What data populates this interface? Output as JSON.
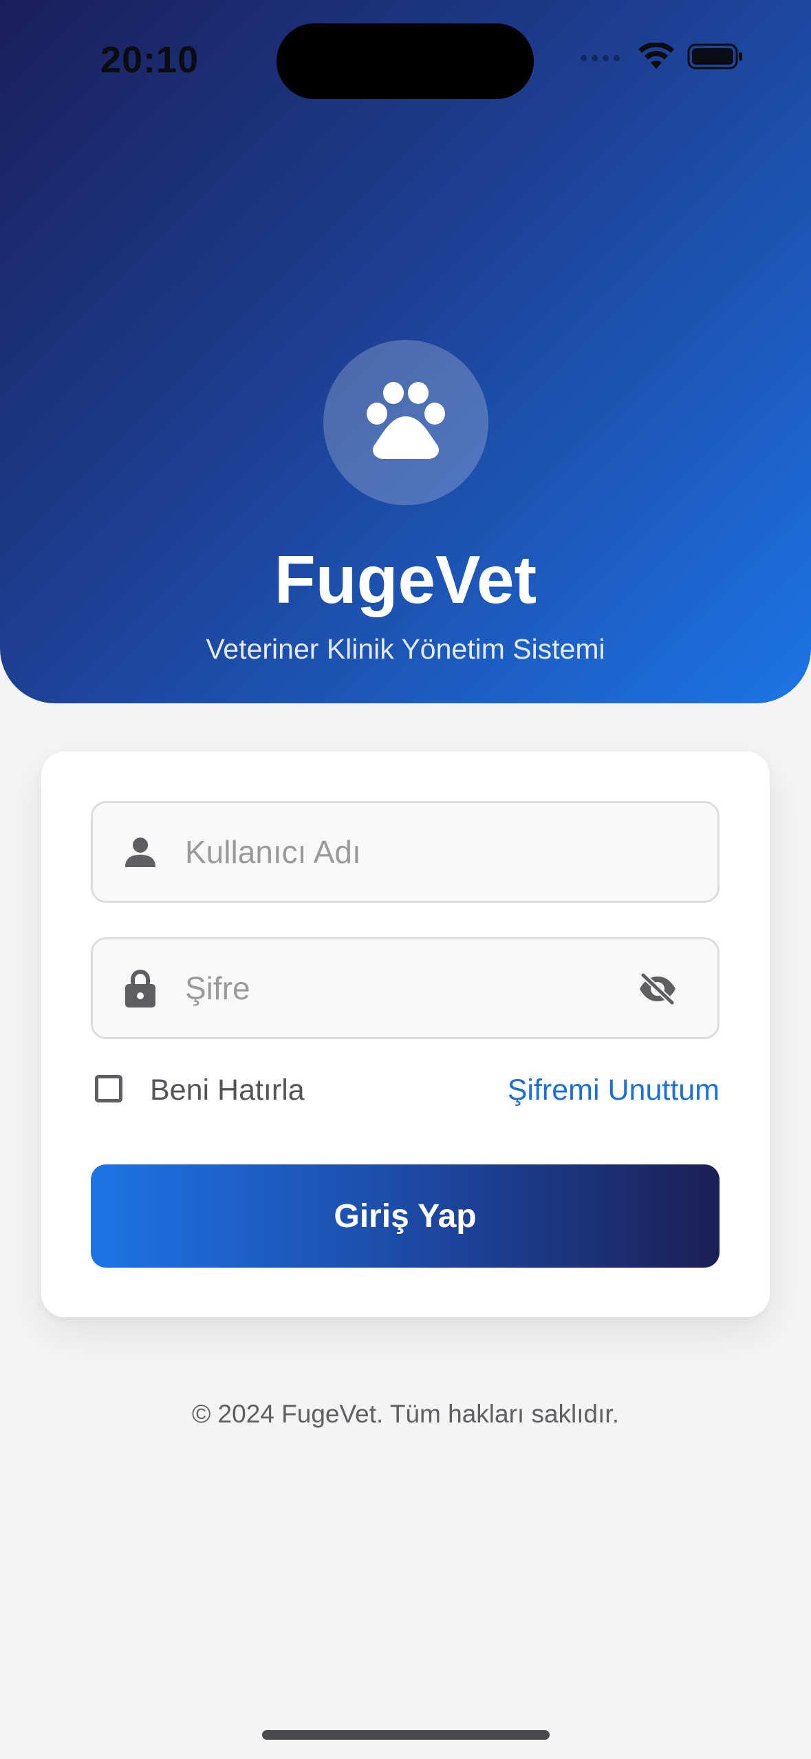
{
  "status_bar": {
    "time": "20:10"
  },
  "header": {
    "logo_icon": "paw-icon",
    "title": "FugeVet",
    "subtitle": "Veteriner Klinik Yönetim Sistemi"
  },
  "login_form": {
    "username": {
      "placeholder": "Kullanıcı Adı",
      "value": "",
      "icon": "person-icon"
    },
    "password": {
      "placeholder": "Şifre",
      "value": "",
      "icon": "lock-icon",
      "toggle_icon": "eye-slash-icon"
    },
    "remember_me": {
      "label": "Beni Hatırla",
      "checked": false
    },
    "forgot_password_label": "Şifremi Unuttum",
    "submit_label": "Giriş Yap"
  },
  "footer": {
    "copyright": "© 2024 FugeVet. Tüm hakları saklıdır."
  },
  "colors": {
    "primary": "#1d74e6",
    "primary_dark": "#1b1f55",
    "link": "#1a6fd9",
    "background": "#f4f4f5"
  }
}
